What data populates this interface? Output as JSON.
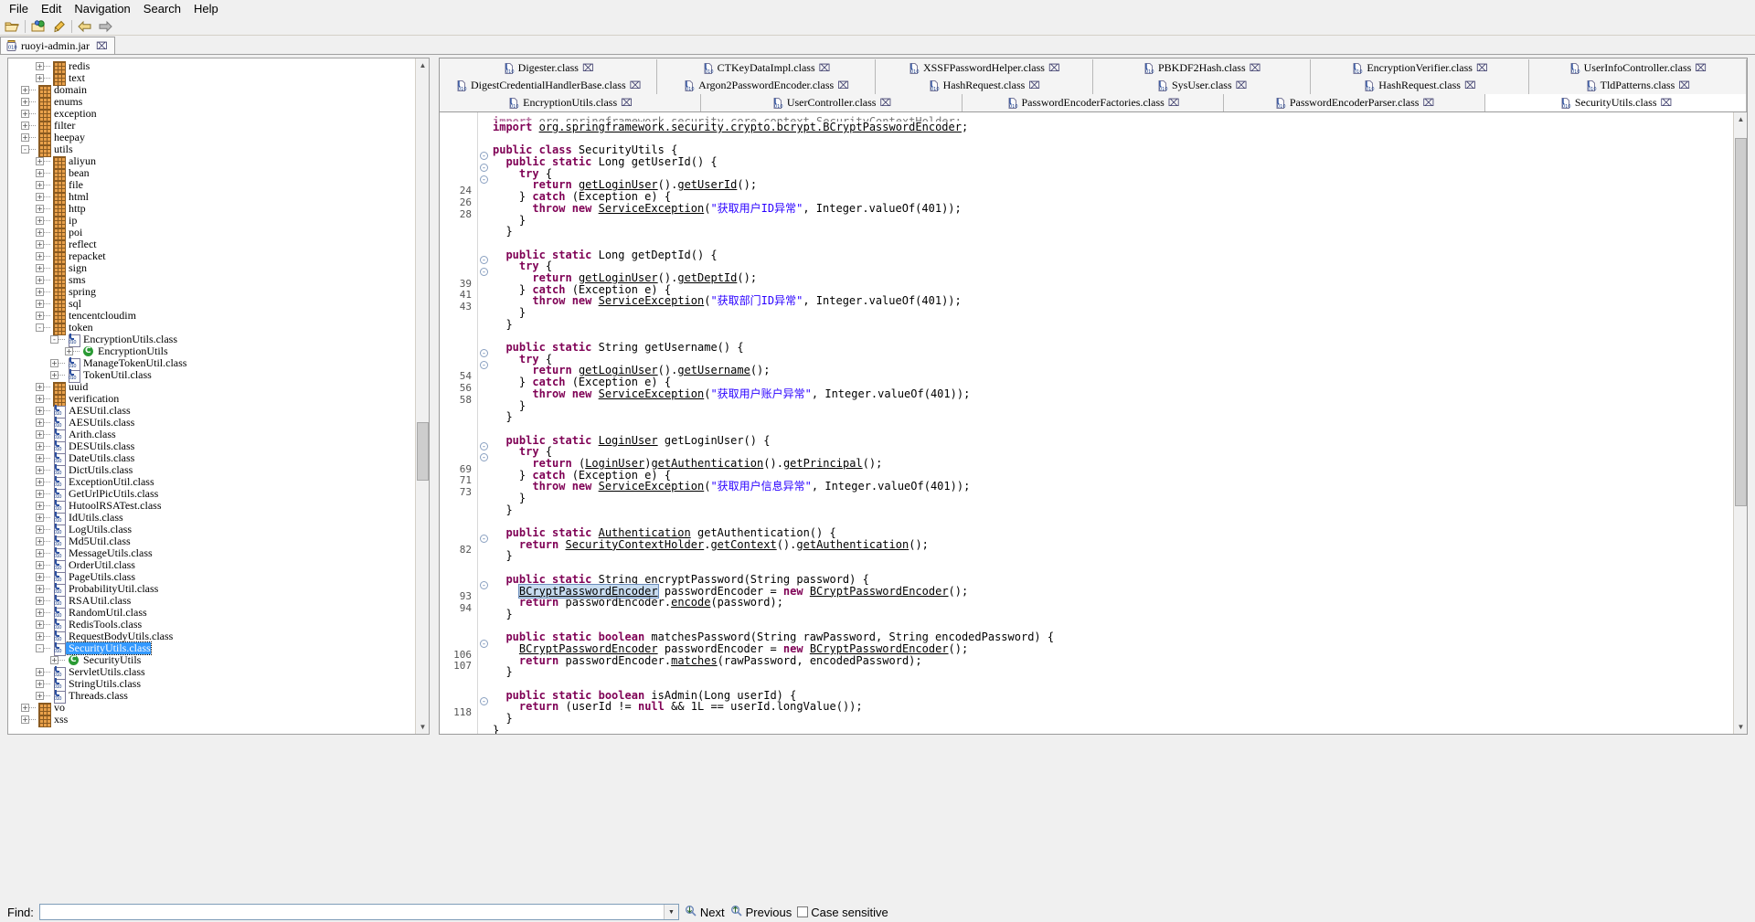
{
  "window": {
    "menu": [
      "File",
      "Edit",
      "Navigation",
      "Search",
      "Help"
    ],
    "toolbar_icons": [
      "open-folder-icon",
      "open-type-icon",
      "search-highlight-icon",
      "back-arrow-icon",
      "forward-arrow-icon"
    ]
  },
  "jar_tab": {
    "label": "ruoyi-admin.jar",
    "close": "⌧",
    "icon": "jar-icon"
  },
  "tree": {
    "scroll_thumb_top_pct": 54,
    "scroll_thumb_height_pct": 9,
    "nodes": [
      {
        "d": 3,
        "t": "pkg",
        "x": "+",
        "label": "redis"
      },
      {
        "d": 3,
        "t": "pkg",
        "x": "+",
        "label": "text"
      },
      {
        "d": 2,
        "t": "pkg",
        "x": "+",
        "label": "domain"
      },
      {
        "d": 2,
        "t": "pkg",
        "x": "+",
        "label": "enums"
      },
      {
        "d": 2,
        "t": "pkg",
        "x": "+",
        "label": "exception"
      },
      {
        "d": 2,
        "t": "pkg",
        "x": "+",
        "label": "filter"
      },
      {
        "d": 2,
        "t": "pkg",
        "x": "+",
        "label": "heepay"
      },
      {
        "d": 2,
        "t": "pkg",
        "x": "-",
        "label": "utils"
      },
      {
        "d": 3,
        "t": "pkg",
        "x": "+",
        "label": "aliyun"
      },
      {
        "d": 3,
        "t": "pkg",
        "x": "+",
        "label": "bean"
      },
      {
        "d": 3,
        "t": "pkg",
        "x": "+",
        "label": "file"
      },
      {
        "d": 3,
        "t": "pkg",
        "x": "+",
        "label": "html"
      },
      {
        "d": 3,
        "t": "pkg",
        "x": "+",
        "label": "http"
      },
      {
        "d": 3,
        "t": "pkg",
        "x": "+",
        "label": "ip"
      },
      {
        "d": 3,
        "t": "pkg",
        "x": "+",
        "label": "poi"
      },
      {
        "d": 3,
        "t": "pkg",
        "x": "+",
        "label": "reflect"
      },
      {
        "d": 3,
        "t": "pkg",
        "x": "+",
        "label": "repacket"
      },
      {
        "d": 3,
        "t": "pkg",
        "x": "+",
        "label": "sign"
      },
      {
        "d": 3,
        "t": "pkg",
        "x": "+",
        "label": "sms"
      },
      {
        "d": 3,
        "t": "pkg",
        "x": "+",
        "label": "spring"
      },
      {
        "d": 3,
        "t": "pkg",
        "x": "+",
        "label": "sql"
      },
      {
        "d": 3,
        "t": "pkg",
        "x": "+",
        "label": "tencentcloudim"
      },
      {
        "d": 3,
        "t": "pkg",
        "x": "-",
        "label": "token"
      },
      {
        "d": 4,
        "t": "cls",
        "x": "-",
        "label": "EncryptionUtils.class"
      },
      {
        "d": 5,
        "t": "green",
        "x": "+",
        "label": "EncryptionUtils"
      },
      {
        "d": 4,
        "t": "cls",
        "x": "+",
        "label": "ManageTokenUtil.class"
      },
      {
        "d": 4,
        "t": "cls",
        "x": "+",
        "label": "TokenUtil.class"
      },
      {
        "d": 3,
        "t": "pkg",
        "x": "+",
        "label": "uuid"
      },
      {
        "d": 3,
        "t": "pkg",
        "x": "+",
        "label": "verification"
      },
      {
        "d": 3,
        "t": "cls",
        "x": "+",
        "label": "AESUtil.class"
      },
      {
        "d": 3,
        "t": "cls",
        "x": "+",
        "label": "AESUtils.class"
      },
      {
        "d": 3,
        "t": "cls",
        "x": "+",
        "label": "Arith.class"
      },
      {
        "d": 3,
        "t": "cls",
        "x": "+",
        "label": "DESUtils.class"
      },
      {
        "d": 3,
        "t": "cls",
        "x": "+",
        "label": "DateUtils.class"
      },
      {
        "d": 3,
        "t": "cls",
        "x": "+",
        "label": "DictUtils.class"
      },
      {
        "d": 3,
        "t": "cls",
        "x": "+",
        "label": "ExceptionUtil.class"
      },
      {
        "d": 3,
        "t": "cls",
        "x": "+",
        "label": "GetUrlPicUtils.class"
      },
      {
        "d": 3,
        "t": "cls",
        "x": "+",
        "label": "HutoolRSATest.class"
      },
      {
        "d": 3,
        "t": "cls",
        "x": "+",
        "label": "IdUtils.class"
      },
      {
        "d": 3,
        "t": "cls",
        "x": "+",
        "label": "LogUtils.class"
      },
      {
        "d": 3,
        "t": "cls",
        "x": "+",
        "label": "Md5Util.class"
      },
      {
        "d": 3,
        "t": "cls",
        "x": "+",
        "label": "MessageUtils.class"
      },
      {
        "d": 3,
        "t": "cls",
        "x": "+",
        "label": "OrderUtil.class"
      },
      {
        "d": 3,
        "t": "cls",
        "x": "+",
        "label": "PageUtils.class"
      },
      {
        "d": 3,
        "t": "cls",
        "x": "+",
        "label": "ProbabilityUtil.class"
      },
      {
        "d": 3,
        "t": "cls",
        "x": "+",
        "label": "RSAUtil.class"
      },
      {
        "d": 3,
        "t": "cls",
        "x": "+",
        "label": "RandomUtil.class"
      },
      {
        "d": 3,
        "t": "cls",
        "x": "+",
        "label": "RedisTools.class"
      },
      {
        "d": 3,
        "t": "cls",
        "x": "+",
        "label": "RequestBodyUtils.class"
      },
      {
        "d": 3,
        "t": "cls",
        "x": "-",
        "label": "SecurityUtils.class",
        "selected": true
      },
      {
        "d": 4,
        "t": "green",
        "x": "+",
        "label": "SecurityUtils"
      },
      {
        "d": 3,
        "t": "cls",
        "x": "+",
        "label": "ServletUtils.class"
      },
      {
        "d": 3,
        "t": "cls",
        "x": "+",
        "label": "StringUtils.class"
      },
      {
        "d": 3,
        "t": "cls",
        "x": "+",
        "label": "Threads.class"
      },
      {
        "d": 2,
        "t": "pkg",
        "x": "+",
        "label": "vo"
      },
      {
        "d": 2,
        "t": "pkg",
        "x": "+",
        "label": "xss"
      }
    ]
  },
  "editor": {
    "tab_rows": [
      [
        {
          "label": "Digester.class",
          "active": false
        },
        {
          "label": "CTKeyDataImpl.class",
          "active": false
        },
        {
          "label": "XSSFPasswordHelper.class",
          "active": false
        },
        {
          "label": "PBKDF2Hash.class",
          "active": false
        },
        {
          "label": "EncryptionVerifier.class",
          "active": false
        },
        {
          "label": "UserInfoController.class",
          "active": false
        }
      ],
      [
        {
          "label": "DigestCredentialHandlerBase.class",
          "active": false
        },
        {
          "label": "Argon2PasswordEncoder.class",
          "active": false
        },
        {
          "label": "HashRequest.class",
          "active": false
        },
        {
          "label": "SysUser.class",
          "active": false
        },
        {
          "label": "HashRequest.class",
          "active": false
        },
        {
          "label": "TldPatterns.class",
          "active": false
        }
      ],
      [
        {
          "label": "EncryptionUtils.class",
          "active": false
        },
        {
          "label": "UserController.class",
          "active": false
        },
        {
          "label": "PasswordEncoderFactories.class",
          "active": false
        },
        {
          "label": "PasswordEncoderParser.class",
          "active": false
        },
        {
          "label": "SecurityUtils.class",
          "active": true
        }
      ]
    ],
    "scroll_thumb_top_pct": 2,
    "scroll_thumb_height_pct": 62,
    "code_lines": [
      {
        "num": "",
        "fold": "",
        "clipped": true,
        "html": "<span class=\"k\">import</span> <span class=\"ty\">org.springframework.security.core.context.SecurityContextHolder</span>;"
      },
      {
        "num": "",
        "fold": "",
        "html": "<span class=\"k\">import</span> <span class=\"ty\">org.springframework.security.crypto.bcrypt.BCryptPasswordEncoder</span>;"
      },
      {
        "num": "",
        "fold": "",
        "html": ""
      },
      {
        "num": "",
        "fold": "-",
        "html": "<span class=\"k\">public class</span> SecurityUtils {"
      },
      {
        "num": "",
        "fold": "-",
        "html": "  <span class=\"k\">public static</span> <span class=\"t\">Long</span> getUserId() {"
      },
      {
        "num": "",
        "fold": "-",
        "html": "    <span class=\"k\">try</span> {"
      },
      {
        "num": "24",
        "fold": "",
        "html": "      <span class=\"k\">return</span> <span class=\"m\">getLoginUser</span>().<span class=\"m\">getUserId</span>();"
      },
      {
        "num": "26",
        "fold": "",
        "html": "    } <span class=\"k\">catch</span> (Exception e) {"
      },
      {
        "num": "28",
        "fold": "",
        "html": "      <span class=\"k\">throw new</span> <span class=\"ty\">ServiceException</span>(<span class=\"s\">\"获取用户ID异常\"</span>, Integer.valueOf(401));"
      },
      {
        "num": "",
        "fold": "",
        "html": "    }"
      },
      {
        "num": "",
        "fold": "",
        "html": "  }"
      },
      {
        "num": "",
        "fold": "",
        "html": ""
      },
      {
        "num": "",
        "fold": "-",
        "html": "  <span class=\"k\">public static</span> <span class=\"t\">Long</span> getDeptId() {"
      },
      {
        "num": "",
        "fold": "-",
        "html": "    <span class=\"k\">try</span> {"
      },
      {
        "num": "39",
        "fold": "",
        "html": "      <span class=\"k\">return</span> <span class=\"m\">getLoginUser</span>().<span class=\"m\">getDeptId</span>();"
      },
      {
        "num": "41",
        "fold": "",
        "html": "    } <span class=\"k\">catch</span> (Exception e) {"
      },
      {
        "num": "43",
        "fold": "",
        "html": "      <span class=\"k\">throw new</span> <span class=\"ty\">ServiceException</span>(<span class=\"s\">\"获取部门ID异常\"</span>, Integer.valueOf(401));"
      },
      {
        "num": "",
        "fold": "",
        "html": "    }"
      },
      {
        "num": "",
        "fold": "",
        "html": "  }"
      },
      {
        "num": "",
        "fold": "",
        "html": ""
      },
      {
        "num": "",
        "fold": "-",
        "html": "  <span class=\"k\">public static</span> <span class=\"t\">String</span> getUsername() {"
      },
      {
        "num": "",
        "fold": "-",
        "html": "    <span class=\"k\">try</span> {"
      },
      {
        "num": "54",
        "fold": "",
        "html": "      <span class=\"k\">return</span> <span class=\"m\">getLoginUser</span>().<span class=\"m\">getUsername</span>();"
      },
      {
        "num": "56",
        "fold": "",
        "html": "    } <span class=\"k\">catch</span> (Exception e) {"
      },
      {
        "num": "58",
        "fold": "",
        "html": "      <span class=\"k\">throw new</span> <span class=\"ty\">ServiceException</span>(<span class=\"s\">\"获取用户账户异常\"</span>, Integer.valueOf(401));"
      },
      {
        "num": "",
        "fold": "",
        "html": "    }"
      },
      {
        "num": "",
        "fold": "",
        "html": "  }"
      },
      {
        "num": "",
        "fold": "",
        "html": ""
      },
      {
        "num": "",
        "fold": "-",
        "html": "  <span class=\"k\">public static</span> <span class=\"ty\">LoginUser</span> getLoginUser() {"
      },
      {
        "num": "",
        "fold": "-",
        "html": "    <span class=\"k\">try</span> {"
      },
      {
        "num": "69",
        "fold": "",
        "html": "      <span class=\"k\">return</span> (<span class=\"ty\">LoginUser</span>)<span class=\"m\">getAuthentication</span>().<span class=\"m\">getPrincipal</span>();"
      },
      {
        "num": "71",
        "fold": "",
        "html": "    } <span class=\"k\">catch</span> (Exception e) {"
      },
      {
        "num": "73",
        "fold": "",
        "html": "      <span class=\"k\">throw new</span> <span class=\"ty\">ServiceException</span>(<span class=\"s\">\"获取用户信息异常\"</span>, Integer.valueOf(401));"
      },
      {
        "num": "",
        "fold": "",
        "html": "    }"
      },
      {
        "num": "",
        "fold": "",
        "html": "  }"
      },
      {
        "num": "",
        "fold": "",
        "html": ""
      },
      {
        "num": "",
        "fold": "-",
        "html": "  <span class=\"k\">public static</span> <span class=\"ty\">Authentication</span> getAuthentication() {"
      },
      {
        "num": "82",
        "fold": "",
        "html": "    <span class=\"k\">return</span> <span class=\"ty\">SecurityContextHolder</span>.<span class=\"m\">getContext</span>().<span class=\"m\">getAuthentication</span>();"
      },
      {
        "num": "",
        "fold": "",
        "html": "  }"
      },
      {
        "num": "",
        "fold": "",
        "html": ""
      },
      {
        "num": "",
        "fold": "-",
        "html": "  <span class=\"k\">public static</span> <span class=\"t\">String</span> encryptPassword(String password) {"
      },
      {
        "num": "93",
        "fold": "",
        "html": "    <span class=\"hl\"><span class=\"ty\">BCryptPasswordEncoder</span></span> passwordEncoder = <span class=\"k\">new</span> <span class=\"ty\">BCryptPasswordEncoder</span>();"
      },
      {
        "num": "94",
        "fold": "",
        "html": "    <span class=\"k\">return</span> passwordEncoder.<span class=\"m\">encode</span>(password);"
      },
      {
        "num": "",
        "fold": "",
        "html": "  }"
      },
      {
        "num": "",
        "fold": "",
        "html": ""
      },
      {
        "num": "",
        "fold": "-",
        "html": "  <span class=\"k\">public static boolean</span> matchesPassword(String rawPassword, String encodedPassword) {"
      },
      {
        "num": "106",
        "fold": "",
        "html": "    <span class=\"ty\">BCryptPasswordEncoder</span> passwordEncoder = <span class=\"k\">new</span> <span class=\"ty\">BCryptPasswordEncoder</span>();"
      },
      {
        "num": "107",
        "fold": "",
        "html": "    <span class=\"k\">return</span> passwordEncoder.<span class=\"m\">matches</span>(rawPassword, encodedPassword);"
      },
      {
        "num": "",
        "fold": "",
        "html": "  }"
      },
      {
        "num": "",
        "fold": "",
        "html": ""
      },
      {
        "num": "",
        "fold": "-",
        "html": "  <span class=\"k\">public static boolean</span> isAdmin(Long userId) {"
      },
      {
        "num": "118",
        "fold": "",
        "html": "    <span class=\"k\">return</span> (userId != <span class=\"k\">null</span> &amp;&amp; 1L == userId.longValue());"
      },
      {
        "num": "",
        "fold": "",
        "html": "  }"
      },
      {
        "num": "",
        "fold": "",
        "html": "}"
      }
    ]
  },
  "findbar": {
    "label": "Find:",
    "value": "",
    "placeholder": "",
    "next_label": "Next",
    "previous_label": "Previous",
    "case_sensitive_label": "Case sensitive",
    "case_sensitive_checked": false
  },
  "colors": {
    "selection_blue": "#3399ff",
    "keyword_magenta": "#7f0055",
    "string_blue": "#2a00ff",
    "highlight_blue": "#c8dcf0",
    "package_orange": "#e8a04a"
  }
}
